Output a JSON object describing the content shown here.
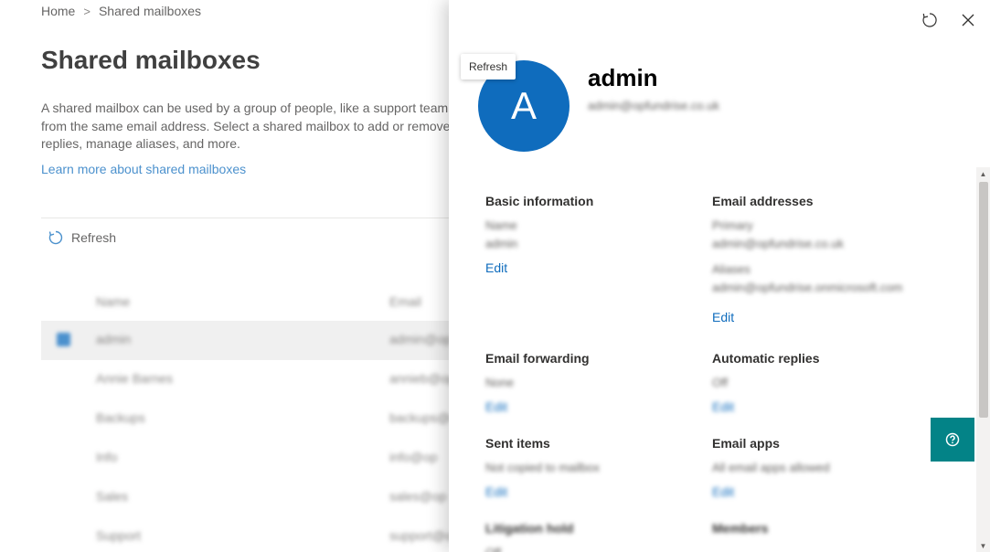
{
  "breadcrumb": {
    "home": "Home",
    "separator": ">",
    "current": "Shared mailboxes"
  },
  "page": {
    "title": "Shared mailboxes",
    "description": "A shared mailbox can be used by a group of people, like a support team,\nfrom the same email address. Select a shared mailbox to add or remove\nreplies, manage aliases, and more.",
    "learn_more": "Learn more about shared mailboxes",
    "refresh_label": "Refresh"
  },
  "table": {
    "headers": {
      "name": "Name",
      "email": "Email"
    },
    "rows": [
      {
        "name": "admin",
        "email": "admin@op"
      },
      {
        "name": "Annie Barnes",
        "email": "annieb@op"
      },
      {
        "name": "Backups",
        "email": "backups@op"
      },
      {
        "name": "Info",
        "email": "info@op"
      },
      {
        "name": "Sales",
        "email": "sales@op"
      },
      {
        "name": "Support",
        "email": "support@op"
      }
    ]
  },
  "panel": {
    "avatar_initial": "A",
    "name": "admin",
    "email": "admin@opfundrise.co.uk",
    "tooltip": "Refresh",
    "accent": "#0f6cbd",
    "help_color": "#038387",
    "sections": {
      "basic": {
        "title": "Basic information",
        "lines": [
          "Name",
          "admin"
        ],
        "link": "Edit"
      },
      "email_addresses": {
        "title": "Email addresses",
        "lines": [
          "Primary",
          "admin@opfundrise.co.uk",
          "Aliases",
          "admin@opfundrise.onmicrosoft.com"
        ],
        "link": "Edit"
      },
      "forwarding": {
        "title": "Email forwarding",
        "lines": [
          "None"
        ],
        "link": "Edit"
      },
      "auto_replies": {
        "title": "Automatic replies",
        "lines": [
          "Off"
        ],
        "link": "Edit"
      },
      "sent_items": {
        "title": "Sent items",
        "lines": [
          "Not copied to mailbox"
        ],
        "link": "Edit"
      },
      "email_apps": {
        "title": "Email apps",
        "lines": [
          "All email apps allowed"
        ],
        "link": "Edit"
      },
      "litigation": {
        "title": "Litigation hold",
        "lines": [
          "Off"
        ]
      },
      "members": {
        "title": "Members"
      }
    }
  }
}
